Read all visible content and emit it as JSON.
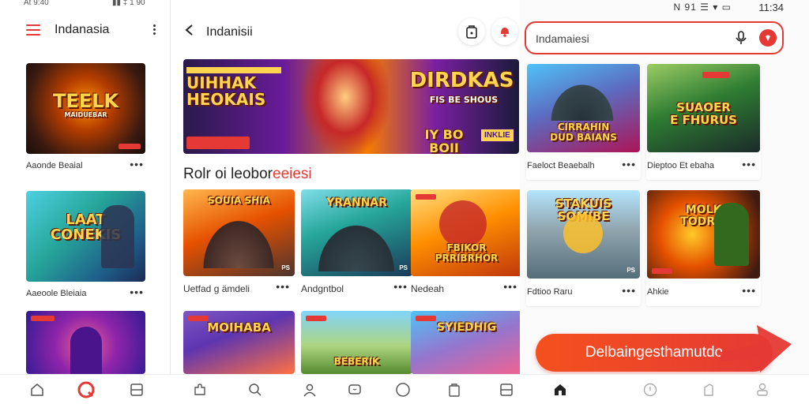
{
  "left_pane": {
    "status_time": "At 9:40",
    "status_icons": "▮▮ ‡ 1 90",
    "app_title": "Indanasia",
    "cards": [
      {
        "caption": "Aaonde Beaial",
        "art_text": "TEELK",
        "art_sub": "MAIDUEBAR"
      },
      {
        "caption": "Aaeoole Bleiaia",
        "art_text": "LAAT\nCONEKIS",
        "art_sub": ""
      },
      {
        "caption": "",
        "art_text": "",
        "art_sub": ""
      }
    ]
  },
  "middle_pane": {
    "title": "Indanisii",
    "banner": {
      "left_text": "UIHHAK\nHEOKAIS",
      "right_text": "DIRDKAS",
      "right_sub": "FIS BE SHOUS",
      "bottom_text": "IY BO BOII",
      "bottom_badge": "INKLIE"
    },
    "section_title_prefix": "Rolr oi leobor",
    "section_title_highlight": "eeiesi",
    "cards": [
      {
        "caption": "Uetfad g ämdeli",
        "art_text": "SOUIA SHIA",
        "tag": "PS"
      },
      {
        "caption": "Andgntbol",
        "art_text": "YRANNAR",
        "tag": "PS"
      },
      {
        "caption": "Nedeah",
        "art_text": "FBIKOR\nPRRIBRHOR",
        "tag": ""
      },
      {
        "caption": "",
        "art_text": "MOIHABA",
        "tag": ""
      },
      {
        "caption": "",
        "art_text": "BEBERIK",
        "tag": ""
      },
      {
        "caption": "",
        "art_text": "SYIEDHIG",
        "tag": ""
      }
    ]
  },
  "right_pane": {
    "status_time": "11:34",
    "status_icons": "N 91 ☰ ▾ ▭",
    "search_value": "Indamaiesi",
    "cards": [
      {
        "caption": "Faeloct Beaebalh",
        "art_text": "CIRRAHIN\nDUD BAIANS"
      },
      {
        "caption": "Dieptoo Et ebaha",
        "art_text": "SUAOER\nE FHURUS"
      },
      {
        "caption": "Fdtioo Raru",
        "art_text": "STAKUIS\nSOMIBE"
      },
      {
        "caption": "Ahkie",
        "art_text": "MOLK\nTODRIE"
      }
    ],
    "cta_label": "Delbaingesthamutdo"
  },
  "colors": {
    "accent": "#e53935",
    "cta_start": "#f4511e"
  }
}
